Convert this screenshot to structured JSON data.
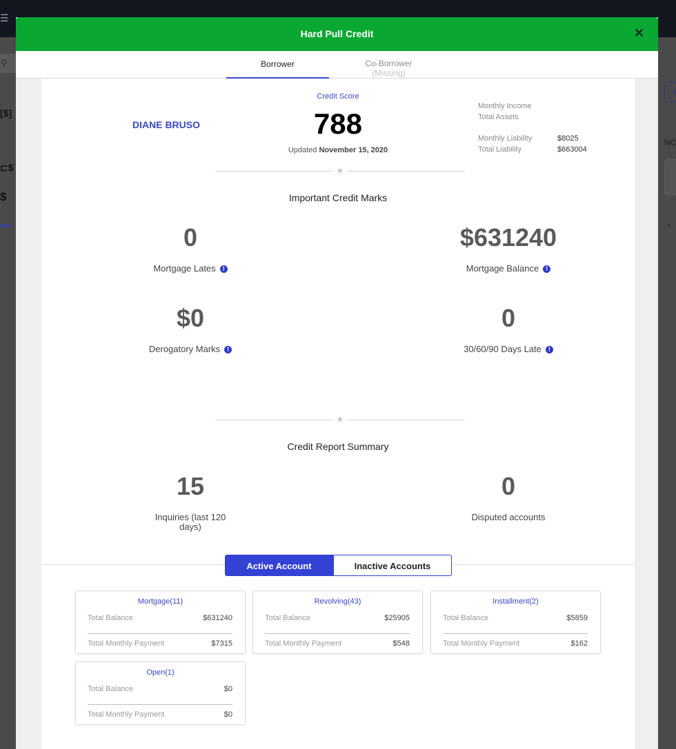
{
  "background": {
    "menu_icon": "☰",
    "search_icon": "⚲",
    "money_icon": "[$]",
    "folder_money_icon": "⊏$",
    "dollar_refresh_icon": "$",
    "more_dots": "•••",
    "right_button_text": "E",
    "right_label": "NC",
    "right_dot": "•"
  },
  "modal": {
    "title": "Hard Pull Credit",
    "close_glyph": "✕",
    "tabs": {
      "borrower": "Borrower",
      "coborrower": "Co-Borrower",
      "coborrower_sub": "(Missing)"
    },
    "header_color": "#0aa832",
    "accent_color": "#3341d4"
  },
  "borrower": {
    "name": "DIANE BRUSO",
    "credit_score_label": "Credit Score",
    "credit_score": "788",
    "updated_prefix": "Updated",
    "updated_date": "November 15, 2020",
    "financials": {
      "monthly_income_label": "Monthly Income",
      "monthly_income_value": "",
      "total_assets_label": "Total Assets",
      "total_assets_value": "",
      "monthly_liability_label": "Monthly Liability",
      "monthly_liability_value": "$8025",
      "total_liability_label": "Total Liability",
      "total_liability_value": "$663004"
    }
  },
  "important_marks": {
    "title": "Important Credit Marks",
    "star": "★",
    "mortgage_lates": {
      "value": "0",
      "label": "Mortgage Lates"
    },
    "mortgage_balance": {
      "value": "$631240",
      "label": "Mortgage Balance"
    },
    "derogatory_marks": {
      "value": "$0",
      "label": "Derogatory Marks"
    },
    "days_late": {
      "value": "0",
      "label": "30/60/90 Days Late"
    },
    "info_glyph": "!"
  },
  "summary": {
    "title": "Credit Report Summary",
    "inquiries": {
      "value": "15",
      "label": "Inquiries (last 120 days)"
    },
    "disputed": {
      "value": "0",
      "label": "Disputed accounts"
    }
  },
  "accounts": {
    "active_tab": "Active Account",
    "inactive_tab": "Inactive Accounts",
    "cards": [
      {
        "title": "Mortgage(11)",
        "balance_label": "Total Balance",
        "balance": "$631240",
        "payment_label": "Total Monthly Payment",
        "payment": "$7315"
      },
      {
        "title": "Revolving(43)",
        "balance_label": "Total Balance",
        "balance": "$25905",
        "payment_label": "Total Monthly Payment",
        "payment": "$548"
      },
      {
        "title": "Installment(2)",
        "balance_label": "Total Balance",
        "balance": "$5859",
        "payment_label": "Total Monthly Payment",
        "payment": "$162"
      },
      {
        "title": "Open(1)",
        "balance_label": "Total Balance",
        "balance": "$0",
        "payment_label": "Total Monthly Payment",
        "payment": "$0"
      }
    ]
  }
}
